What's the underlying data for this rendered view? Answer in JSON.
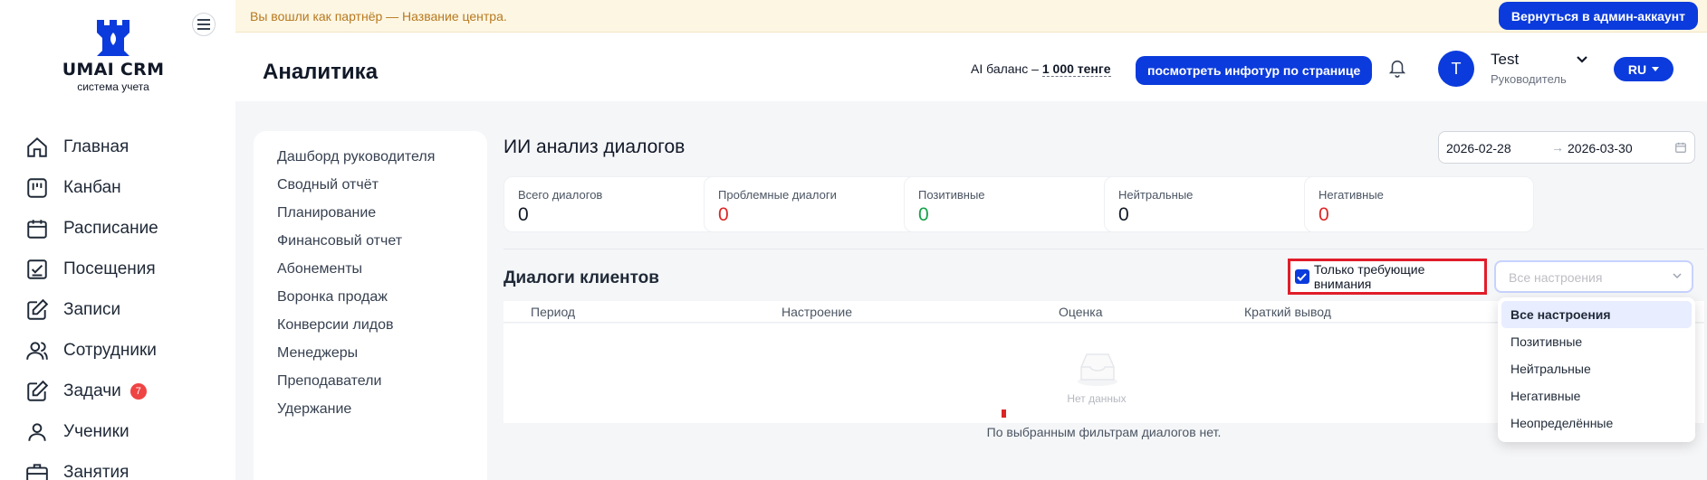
{
  "brand": {
    "name": "UMAI CRM",
    "tagline": "система учета"
  },
  "sidebar": {
    "items": [
      {
        "label": "Главная",
        "icon": "home-icon"
      },
      {
        "label": "Канбан",
        "icon": "kanban-icon"
      },
      {
        "label": "Расписание",
        "icon": "calendar-icon"
      },
      {
        "label": "Посещения",
        "icon": "attendance-icon"
      },
      {
        "label": "Записи",
        "icon": "edit-icon"
      },
      {
        "label": "Сотрудники",
        "icon": "users-icon"
      },
      {
        "label": "Задачи",
        "icon": "tasks-icon",
        "badge": "7"
      },
      {
        "label": "Ученики",
        "icon": "user-icon"
      },
      {
        "label": "Занятия",
        "icon": "briefcase-icon"
      }
    ]
  },
  "banner": {
    "text": "Вы вошли как партнёр — Название центра.",
    "back_button": "Вернуться в админ-аккаунт"
  },
  "header": {
    "title": "Аналитика",
    "ai_balance_label": "AI баланс –",
    "ai_balance_value": "1 000 тенге",
    "tour_button": "посмотреть инфотур по странице",
    "user": {
      "initial": "T",
      "name": "Test",
      "role": "Руководитель"
    },
    "language": "RU"
  },
  "reports": [
    "Дашборд руководителя",
    "Сводный отчёт",
    "Планирование",
    "Финансовый отчет",
    "Абонементы",
    "Воронка продаж",
    "Конверсии лидов",
    "Менеджеры",
    "Преподаватели",
    "Удержание"
  ],
  "main": {
    "title": "ИИ анализ диалогов",
    "date_from": "2026-02-28",
    "date_arrow": "→",
    "date_to": "2026-03-30",
    "stats": [
      {
        "label": "Всего диалогов",
        "value": "0",
        "color": "#111827"
      },
      {
        "label": "Проблемные диалоги",
        "value": "0",
        "color": "#dc2626"
      },
      {
        "label": "Позитивные",
        "value": "0",
        "color": "#16a34a"
      },
      {
        "label": "Нейтральные",
        "value": "0",
        "color": "#111827"
      },
      {
        "label": "Негативные",
        "value": "0",
        "color": "#dc2626"
      }
    ],
    "section_title": "Диалоги клиентов",
    "attention_checkbox": {
      "label": "Только требующие внимания",
      "checked": true
    },
    "mood_select": {
      "placeholder": "Все настроения"
    },
    "columns": [
      "Период",
      "Настроение",
      "Оценка",
      "Краткий вывод"
    ],
    "empty_text": "Нет данных",
    "footer_note": "По выбранным фильтрам диалогов нет."
  },
  "dropdown": {
    "options": [
      "Все настроения",
      "Позитивные",
      "Нейтральные",
      "Негативные",
      "Неопределённые"
    ],
    "selected": "Все настроения"
  },
  "colors": {
    "primary": "#0b3bdc",
    "danger": "#dc2626",
    "success": "#16a34a",
    "banner_bg": "#fdf6e3"
  }
}
